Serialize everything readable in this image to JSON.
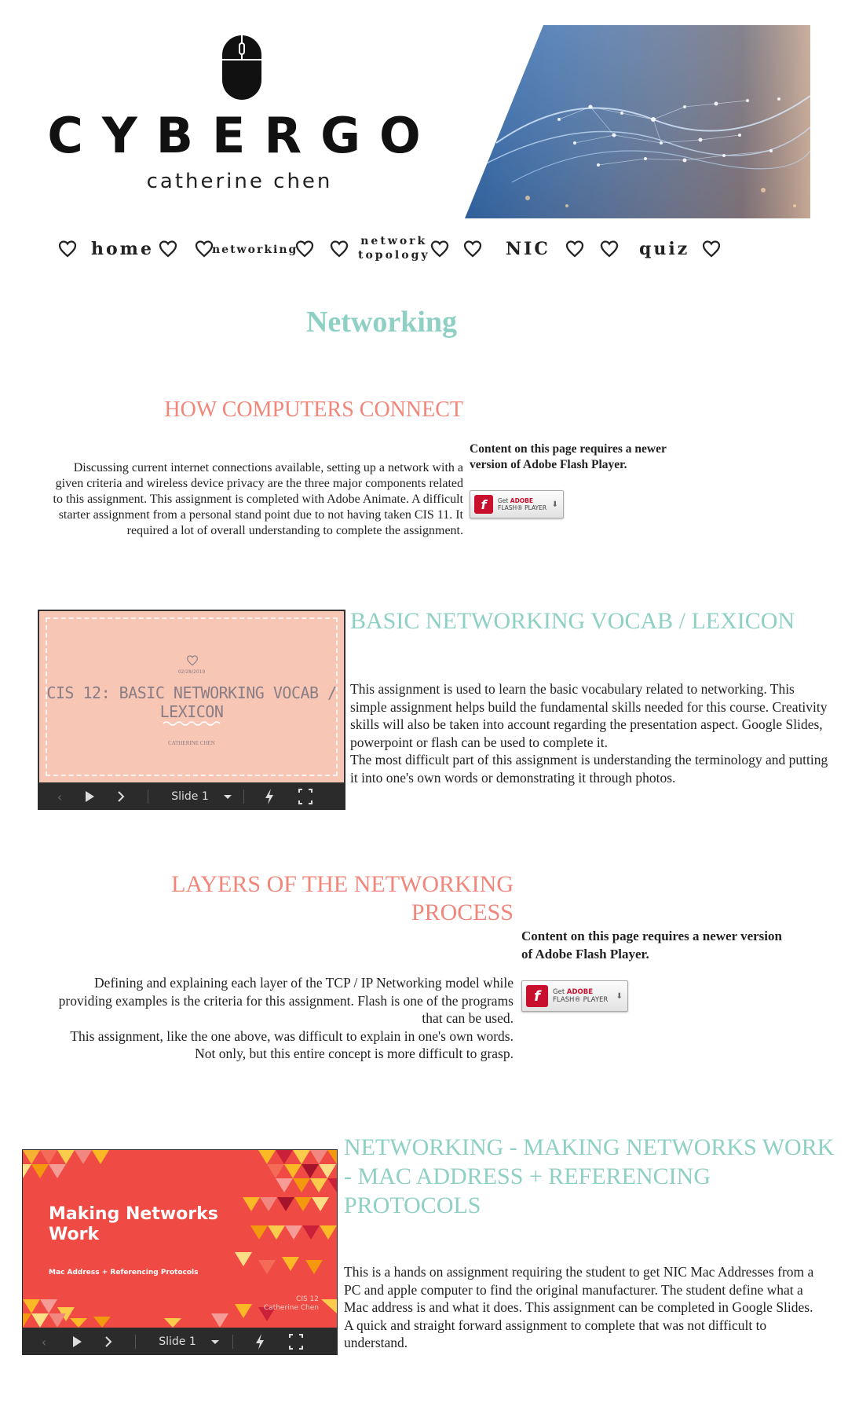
{
  "header": {
    "logo_word": "CYBERGO",
    "logo_sub": "catherine chen"
  },
  "nav": {
    "items": [
      {
        "label": "home"
      },
      {
        "label": "networking"
      },
      {
        "label_line1": "network",
        "label_line2": "topology"
      },
      {
        "label": "NIC"
      },
      {
        "label": "quiz"
      }
    ]
  },
  "page": {
    "title": "Networking"
  },
  "flash": {
    "notice": "Content on this page requires a newer version of Adobe Flash Player.",
    "button_get": "Get",
    "button_adobe": "ADOBE",
    "button_flash": "FLASH® PLAYER"
  },
  "sections": [
    {
      "heading": "HOW COMPUTERS CONNECT",
      "text": "Discussing current internet connections available, setting up a network with a given criteria and wireless device privacy are the three major components related to this assignment. This assignment is completed with Adobe Animate. A difficult starter assignment from a personal stand point due to not having taken CIS 11. It required a lot of overall understanding to complete the assignment."
    },
    {
      "heading": "BASIC NETWORKING VOCAB / LEXICON",
      "text_p1": "This assignment is used to learn the basic vocabulary related to networking. This simple assignment helps build the fundamental skills needed for this course. Creativity skills will also be taken into account regarding the presentation aspect. Google Slides, powerpoint or flash can be used to complete it.",
      "text_p2": "The most difficult part of this assignment is understanding the terminology and putting it into one's own words or demonstrating it through photos.",
      "slide": {
        "date": "02/28/2019",
        "title": "CIS 12: BASIC NETWORKING VOCAB / LEXICON",
        "author": "CATHERINE CHEN",
        "slide_label": "Slide 1"
      }
    },
    {
      "heading_line1": "LAYERS OF THE NETWORKING",
      "heading_line2": "PROCESS",
      "text_p1": "Defining and explaining each layer of the TCP / IP Networking model while providing examples is the criteria for this assignment. Flash is one of the programs that can be used.",
      "text_p2": "This assignment, like the one above, was difficult to explain in one's own words. Not only, but this entire concept is more difficult to grasp."
    },
    {
      "heading": "NETWORKING - MAKING NETWORKS WORK - MAC ADDRESS + REFERENCING PROTOCOLS",
      "text_p1": "This is a hands on assignment requiring the student to get NIC Mac Addresses from a PC and apple computer to find the original manufacturer. The student define what a Mac address is and what it does. This assignment can be completed in Google Slides.",
      "text_p2": "A quick and straight forward assignment to complete that was not difficult to understand.",
      "slide": {
        "title": "Making Networks Work",
        "subtitle": "Mac Address + Referencing Protocols",
        "course": "CIS 12",
        "author": "Catherine Chen",
        "slide_label": "Slide 1"
      }
    }
  ],
  "colors": {
    "teal": "#8ed0c4",
    "coral": "#f1867a",
    "slide1_bg": "#f8c6b5",
    "slide2_bg": "#f04a45"
  },
  "icons": [
    "mouse-icon",
    "heart-icon",
    "flash-logo-icon",
    "play-icon",
    "next-icon",
    "dropdown-icon",
    "flash-toggle-icon",
    "fullscreen-icon"
  ]
}
